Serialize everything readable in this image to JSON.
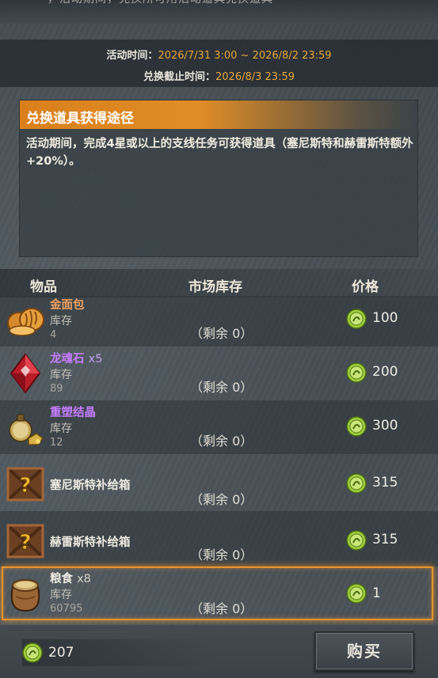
{
  "header": {
    "cut_text": "，活动期间，兑换所可用活动道具兑换道具"
  },
  "times": {
    "activity_label": "活动时间：",
    "activity_value": "2026/7/31 3:00 ~ 2026/8/2 23:59",
    "exchange_label": "兑换截止时间：",
    "exchange_value": "2026/8/3 23:59"
  },
  "info": {
    "title": "兑换道具获得途径",
    "text": "活动期间，完成4星或以上的支线任务可获得道具（塞尼斯特和赫雷斯特额外+20%）。"
  },
  "columns": {
    "item": "物品",
    "stock": "市场库存",
    "price": "价格"
  },
  "items": [
    {
      "name": "金面包",
      "qty": "",
      "stock_label": "库存",
      "stock": "4",
      "remain": "（剩余 0）",
      "price": "100",
      "name_color": "#f0a060",
      "icon": "bread-icon"
    },
    {
      "name": "龙魂石",
      "qty": "x5",
      "stock_label": "库存",
      "stock": "89",
      "remain": "（剩余 0）",
      "price": "200",
      "name_color": "#c77dff",
      "icon": "dragon-soul-stone-icon"
    },
    {
      "name": "重塑结晶",
      "qty": "",
      "stock_label": "库存",
      "stock": "12",
      "remain": "（剩余 0）",
      "price": "300",
      "name_color": "#c77dff",
      "icon": "reshape-crystal-icon"
    },
    {
      "name": "塞尼斯特补给箱",
      "qty": "",
      "stock_label": "",
      "stock": "",
      "remain": "（剩余 0）",
      "price": "315",
      "name_color": "#eeeae0",
      "icon": "mystery-crate-icon"
    },
    {
      "name": "赫雷斯特补给箱",
      "qty": "",
      "stock_label": "",
      "stock": "",
      "remain": "（剩余 0）",
      "price": "315",
      "name_color": "#eeeae0",
      "icon": "mystery-crate-icon"
    },
    {
      "name": "粮食",
      "qty": "x8",
      "stock_label": "库存",
      "stock": "60795",
      "remain": "（剩余 0）",
      "price": "1",
      "name_color": "#eeeae0",
      "icon": "grain-sack-icon"
    }
  ],
  "footer": {
    "balance": "207",
    "buy_label": "购买"
  },
  "colors": {
    "accent": "#e08d27",
    "time_value": "#e6a73a",
    "coin": "#8fbf3a"
  }
}
